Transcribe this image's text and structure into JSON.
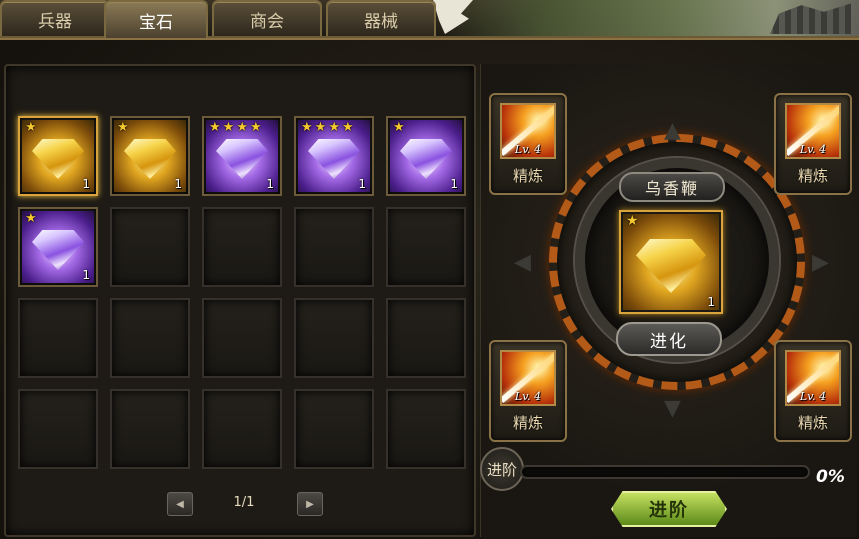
{
  "tabs": [
    {
      "label": "兵器",
      "active": false
    },
    {
      "label": "宝石",
      "active": true
    },
    {
      "label": "商会",
      "active": false
    },
    {
      "label": "器械",
      "active": false
    }
  ],
  "inventory": {
    "items": [
      {
        "color": "yellow",
        "stars": 1,
        "count": "1",
        "selected": true
      },
      {
        "color": "yellow",
        "stars": 1,
        "count": "1",
        "selected": false
      },
      {
        "color": "purple",
        "stars": 4,
        "count": "1",
        "selected": false
      },
      {
        "color": "purple",
        "stars": 4,
        "count": "1",
        "selected": false
      },
      {
        "color": "purple",
        "stars": 1,
        "count": "1",
        "selected": false
      },
      {
        "color": "purple",
        "stars": 1,
        "count": "1",
        "selected": false
      }
    ],
    "pager": {
      "text": "1/1",
      "prev_icon": "arrow-left-icon",
      "next_icon": "arrow-right-icon"
    }
  },
  "skills": [
    {
      "level": "Lv. 4",
      "label": "精炼"
    },
    {
      "level": "Lv. 4",
      "label": "精炼"
    },
    {
      "level": "Lv. 4",
      "label": "精炼"
    },
    {
      "level": "Lv. 4",
      "label": "精炼"
    }
  ],
  "equipment": {
    "name": "乌香鞭",
    "gem": {
      "color": "yellow",
      "stars": 1,
      "count": "1"
    },
    "evolve_label": "进化"
  },
  "progress": {
    "badge": "进阶",
    "value": 0,
    "text": "0%"
  },
  "advance_label": "进阶",
  "colors": {
    "accent": "#d9a43c",
    "ring": "#b35a18",
    "advance": "#8fb030"
  }
}
